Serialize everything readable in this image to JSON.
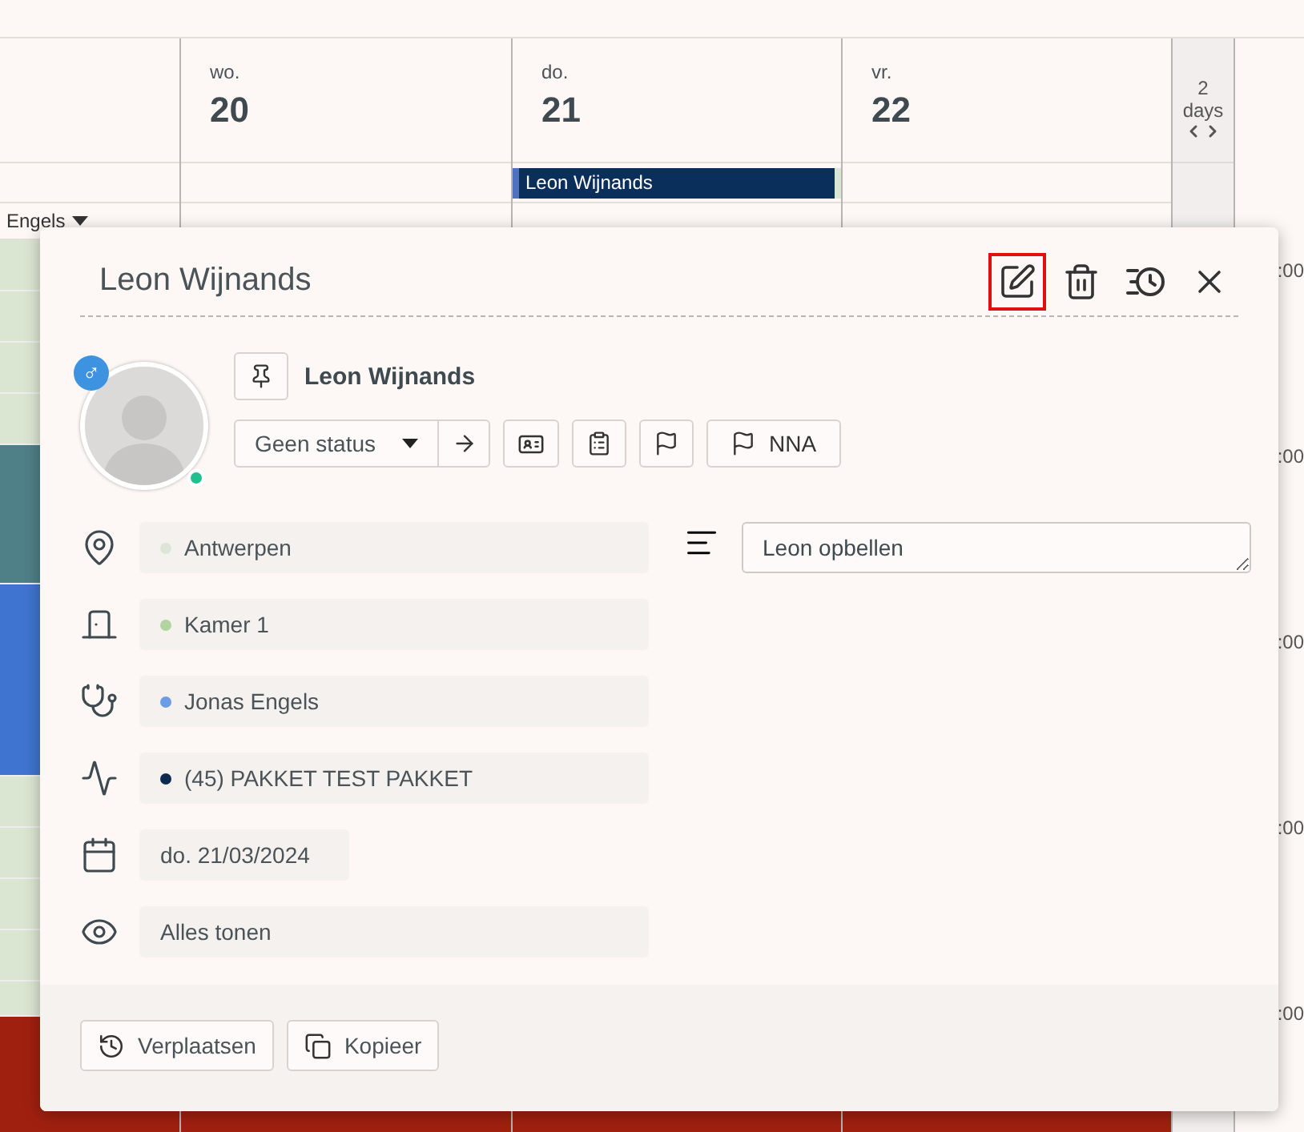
{
  "calendar": {
    "days": [
      {
        "weekday": "wo.",
        "day": "20"
      },
      {
        "weekday": "do.",
        "day": "21",
        "event": "Leon Wijnands"
      },
      {
        "weekday": "vr.",
        "day": "22"
      }
    ],
    "range": {
      "count": "2",
      "unit": "days"
    },
    "resource_label": "Engels",
    "time_labels": [
      ":00",
      ":00",
      ":00",
      ":00",
      ":00"
    ]
  },
  "popup": {
    "title": "Leon Wijnands",
    "actions": [
      {
        "kind": "edit",
        "highlighted": true
      },
      {
        "kind": "delete",
        "highlighted": false
      },
      {
        "kind": "history",
        "highlighted": false
      },
      {
        "kind": "close",
        "highlighted": false
      }
    ],
    "patient": {
      "name": "Leon Wijnands",
      "gender_symbol": "♂",
      "online": true
    },
    "status": "Geen status",
    "tag": "NNA",
    "fields": [
      {
        "kind": "location",
        "text": "Antwerpen",
        "color": "#dde6d6"
      },
      {
        "kind": "room",
        "text": "Kamer 1",
        "color": "#b3d39f"
      },
      {
        "kind": "doctor",
        "text": "Jonas Engels",
        "color": "#6c9ce3"
      },
      {
        "kind": "service",
        "text": "(45) PAKKET TEST PAKKET",
        "color": "#0d2b4e"
      },
      {
        "kind": "date",
        "text": "do. 21/03/2024"
      },
      {
        "kind": "visibility",
        "text": "Alles tonen"
      }
    ],
    "note": "Leon opbellen",
    "buttons": [
      {
        "kind": "move",
        "label": "Verplaatsen"
      },
      {
        "kind": "copy",
        "label": "Kopieer"
      }
    ]
  }
}
